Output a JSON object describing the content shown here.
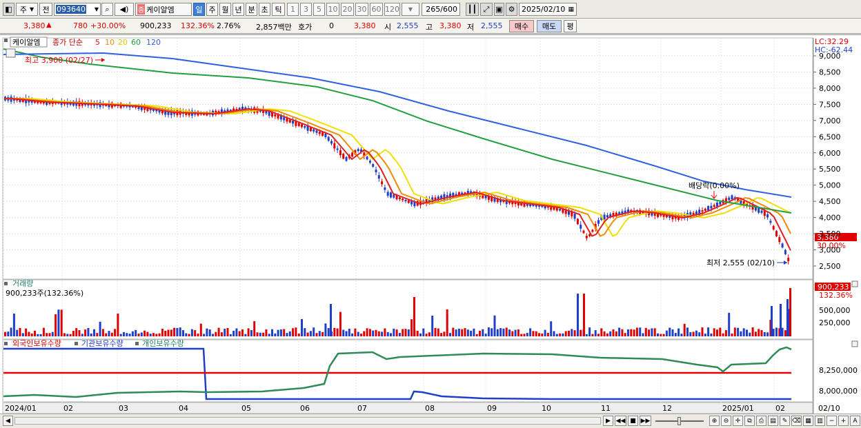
{
  "toolbar": {
    "market_label": "주",
    "prev_label": "전",
    "stock_code": "093640",
    "stock_name_badge": "종",
    "stock_name": "케이알엠",
    "period_tabs": [
      "일",
      "주",
      "월",
      "년",
      "분",
      "초",
      "틱"
    ],
    "period_selected": "일",
    "intervals": [
      "1",
      "3",
      "5",
      "10",
      "20",
      "30",
      "60",
      "120"
    ],
    "count_value": "265",
    "count_max": "/600",
    "date_value": "2025/02/10"
  },
  "quote": {
    "price": "3,380",
    "change": "780",
    "change_pct": "+30.00%",
    "volume": "900,233",
    "volume_ratio": "132.36%",
    "turnover_pct": "2.76%",
    "amount": "2,857백만",
    "hoga_label": "호가",
    "hoga_value": "0",
    "hoga_price": "3,380",
    "open_label": "시",
    "open": "2,555",
    "high_label": "고",
    "high": "3,380",
    "low_label": "저",
    "low": "2,555",
    "buy_label": "매수",
    "sell_label": "매도",
    "eval_label": "평"
  },
  "colors": {
    "up": "#e00000",
    "down": "#1f3fc8",
    "ma5": "#e02020",
    "ma10": "#f08a00",
    "ma20": "#f0e000",
    "ma60": "#20a040",
    "ma120": "#3060e0"
  },
  "price_panel": {
    "name_tag": "케이알엠",
    "indicator_title": "종가 단순",
    "ma_periods": [
      "5",
      "10",
      "20",
      "60",
      "120"
    ],
    "lc_label": "LC:32.29",
    "hc_label": "HC:-62.44",
    "high_annotation": "최고 3,900 (02/27)",
    "low_annotation": "최저 2,555 (02/10)",
    "dividend_annotation": "배당락(0.00%)",
    "current_price_tag": "3,380",
    "current_pct_tag": "30.00%",
    "y_ticks": [
      "9,000",
      "8,500",
      "8,000",
      "7,500",
      "7,000",
      "6,500",
      "6,000",
      "5,500",
      "5,000",
      "4,500",
      "4,000",
      "3,500",
      "3,000",
      "2,500"
    ]
  },
  "volume_panel": {
    "title": "거래량",
    "value_text": "900,233주(132.36%)",
    "current_tag": "900,233",
    "current_pct_tag": "132.36%",
    "y_ticks": [
      "500,000",
      "250,000"
    ]
  },
  "holdings_panel": {
    "legend": [
      "외국인보유수량",
      "기관보유수량",
      "개인보유수량"
    ],
    "y_ticks": [
      "8,250,000",
      "8,000,000"
    ]
  },
  "x_axis": {
    "labels": [
      "2024/01",
      "02",
      "03",
      "04",
      "05",
      "06",
      "07",
      "08",
      "09",
      "10",
      "11",
      "12",
      "2025/01",
      "02"
    ],
    "right_date": "02/10"
  },
  "bottom_bar": {
    "buttons": [
      "▶",
      "◀◀",
      "■",
      "▶▶",
      "−",
      "+",
      "A"
    ]
  }
}
